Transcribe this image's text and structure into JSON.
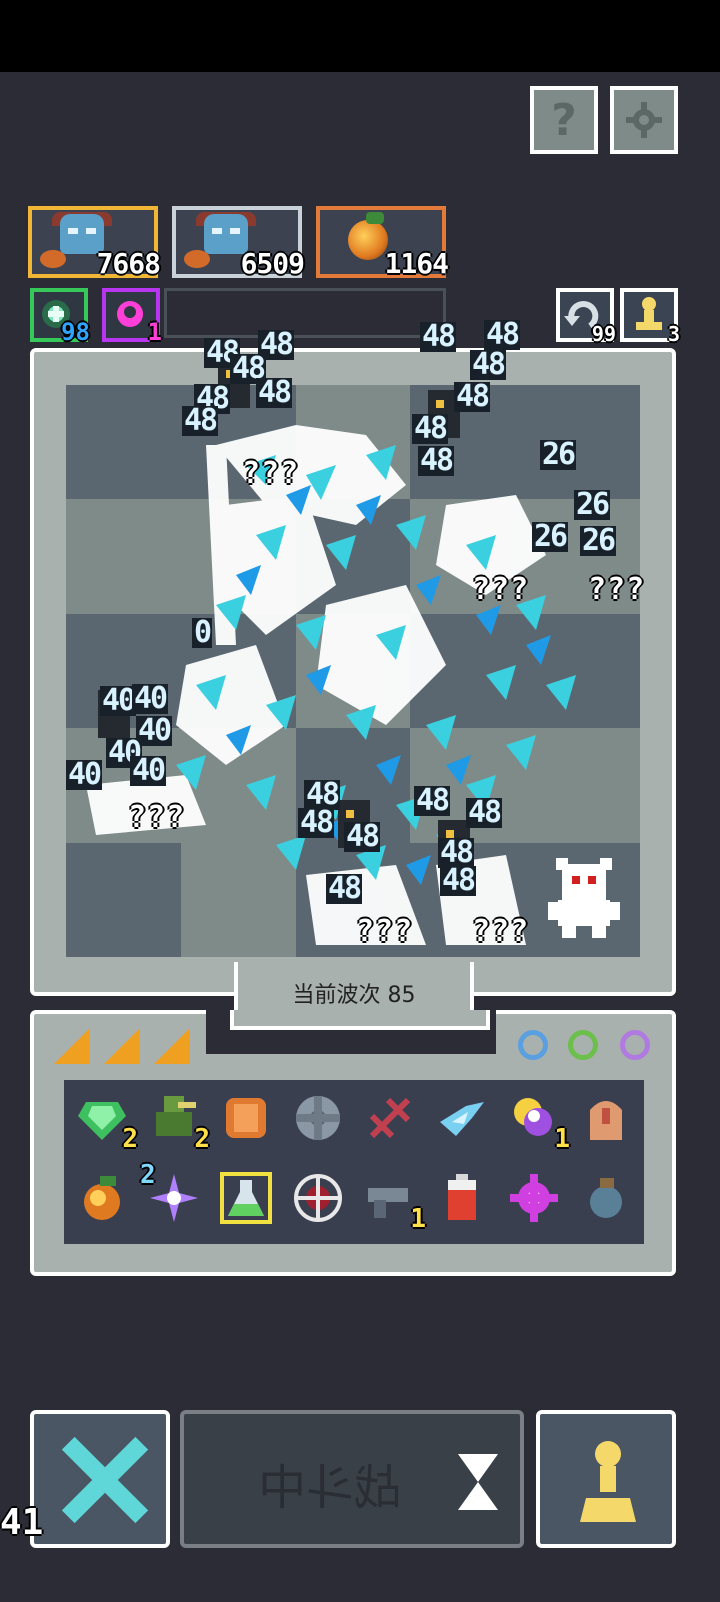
{
  "top_buttons": {
    "help_label": "?",
    "settings_icon": "gear-icon"
  },
  "resources": [
    {
      "icon": "hero-face-icon",
      "value": "7668",
      "border": "#f2b636"
    },
    {
      "icon": "hero-face-icon",
      "value": "6509",
      "border": "#c9d2d8"
    },
    {
      "icon": "fruit-icon",
      "value": "1164",
      "border": "#e37a3a"
    }
  ],
  "skills": [
    {
      "icon": "green-orb-icon",
      "value": "98",
      "border": "#36c95a",
      "color": "#2fa4ff"
    },
    {
      "icon": "pink-orb-icon",
      "value": "1",
      "border": "#b836f0",
      "color": "#ff3fd8"
    }
  ],
  "side_counters": [
    {
      "icon": "refresh-icon",
      "value": "99"
    },
    {
      "icon": "pawn-icon",
      "value": "3"
    }
  ],
  "board": {
    "damage_numbers": [
      "48",
      "48",
      "48",
      "48",
      "48",
      "48",
      "48",
      "48",
      "48",
      "48",
      "48",
      "48",
      "26",
      "26",
      "26",
      "26",
      "40",
      "40",
      "40",
      "40",
      "40",
      "40",
      "48",
      "48",
      "48",
      "48",
      "48",
      "48",
      "48",
      "48",
      "0"
    ],
    "unknown_labels": [
      "???",
      "???",
      "???",
      "???",
      "???",
      "???"
    ]
  },
  "wave_label": "当前波次 85",
  "inventory": {
    "tabs": [
      "tab1",
      "tab2",
      "tab3"
    ],
    "rings": [
      "#5a9fe0",
      "#6bbf4a",
      "#b07ae0"
    ],
    "items_row1": [
      {
        "icon": "green-gem-icon",
        "count": "2"
      },
      {
        "icon": "soldier-icon",
        "count": "2"
      },
      {
        "icon": "armor-icon",
        "count": ""
      },
      {
        "icon": "shield-disc-icon",
        "count": ""
      },
      {
        "icon": "dna-icon",
        "count": ""
      },
      {
        "icon": "bird-icon",
        "count": ""
      },
      {
        "icon": "potion-swirl-icon",
        "count": "1"
      },
      {
        "icon": "tombstone-icon",
        "count": ""
      }
    ],
    "items_row2": [
      {
        "icon": "fruit-icon",
        "count": ""
      },
      {
        "icon": "sparkle-icon",
        "count": "2"
      },
      {
        "icon": "flask-icon",
        "count": ""
      },
      {
        "icon": "crosshair-icon",
        "count": ""
      },
      {
        "icon": "gun-icon",
        "count": "1"
      },
      {
        "icon": "battery-icon",
        "count": ""
      },
      {
        "icon": "cog-flower-icon",
        "count": ""
      },
      {
        "icon": "grenade-icon",
        "count": ""
      }
    ]
  },
  "battle_button": {
    "label": "战斗中"
  },
  "timer": "41"
}
